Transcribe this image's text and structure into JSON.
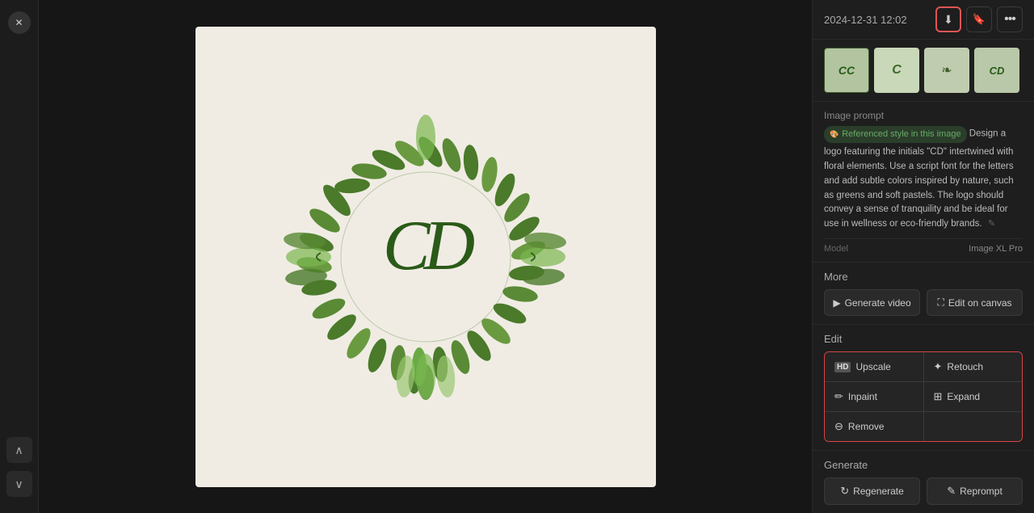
{
  "header": {
    "timestamp": "2024-12-31 12:02",
    "download_label": "⬇",
    "bookmark_label": "🔖",
    "more_label": "•••"
  },
  "thumbnails": [
    {
      "label": "CC",
      "bg": "#b2c4a0"
    },
    {
      "label": "C",
      "bg": "#c8d4b8"
    },
    {
      "label": "❦",
      "bg": "#c0c8b0"
    },
    {
      "label": "CD",
      "bg": "#b8c4a8"
    }
  ],
  "image_prompt": {
    "section_label": "Image prompt",
    "ref_label": "Referenced style in this image",
    "prompt_text": " Design a logo featuring the initials \"CD\" intertwined with floral elements. Use a script font for the letters and add subtle colors inspired by nature, such as greens and soft pastels. The logo should convey a sense of tranquility and be ideal for use in wellness or eco-friendly brands.",
    "edit_icon": "✎",
    "model_label": "Model",
    "model_value": "Image XL Pro"
  },
  "more": {
    "section_label": "More",
    "generate_video_label": "Generate video",
    "edit_on_canvas_label": "Edit on canvas"
  },
  "edit": {
    "section_label": "Edit",
    "upscale_label": "Upscale",
    "retouch_label": "Retouch",
    "inpaint_label": "Inpaint",
    "expand_label": "Expand",
    "remove_label": "Remove"
  },
  "generate": {
    "section_label": "Generate",
    "regenerate_label": "Regenerate",
    "reprompt_label": "Reprompt"
  },
  "nav": {
    "up_label": "∧",
    "down_label": "∨",
    "close_label": "✕"
  }
}
